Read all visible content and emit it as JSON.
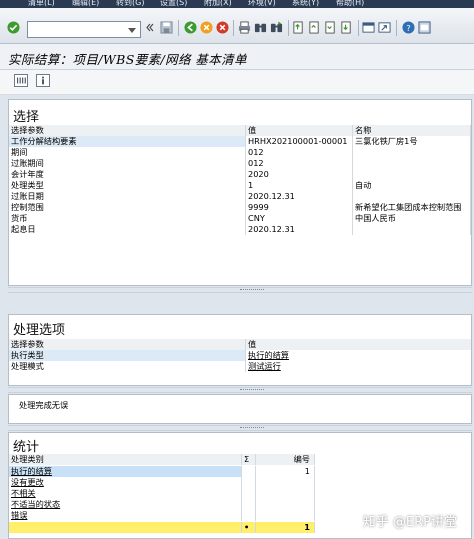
{
  "menu": [
    "清单(L)",
    "编辑(E)",
    "转到(G)",
    "设置(S)",
    "附加(X)",
    "环境(V)",
    "系统(Y)",
    "帮助(H)"
  ],
  "toolbar": {
    "command_field": ""
  },
  "page_title": "实际结算：项目/WBS要素/网络 基本清单",
  "selection": {
    "title": "选择",
    "headers": [
      "选择参数",
      "值",
      "名称"
    ],
    "rows": [
      [
        "工作分解结构要素",
        "HRHX202100001-00001",
        "三氯化铁厂房1号"
      ],
      [
        "期间",
        "012",
        ""
      ],
      [
        "过账期间",
        "012",
        ""
      ],
      [
        "会计年度",
        "2020",
        ""
      ],
      [
        "处理类型",
        "1",
        "自动"
      ],
      [
        "过账日期",
        "2020.12.31",
        ""
      ],
      [
        "控制范围",
        "9999",
        "新希望化工集团成本控制范围"
      ],
      [
        "货币",
        "CNY",
        "中国人民币"
      ],
      [
        "起息日",
        "2020.12.31",
        ""
      ]
    ]
  },
  "processing": {
    "title": "处理选项",
    "headers": [
      "选择参数",
      "值"
    ],
    "rows": [
      [
        "执行类型",
        "执行的结算"
      ],
      [
        "处理模式",
        "测试运行"
      ]
    ]
  },
  "message": "处理完成无误",
  "stats": {
    "title": "统计",
    "headers": [
      "处理类别",
      "Σ",
      "编号"
    ],
    "rows": [
      [
        "执行的结算",
        "",
        "1"
      ],
      [
        "没有更改",
        "",
        ""
      ],
      [
        "不相关",
        "",
        ""
      ],
      [
        "不适当的状态",
        "",
        ""
      ],
      [
        "错误",
        "",
        ""
      ]
    ],
    "total": [
      "",
      "•",
      "1"
    ]
  },
  "watermark": "知乎 @ERP讲堂",
  "colors": {
    "accent": "#0a6ed1",
    "highlight_row": "#dbeaf6",
    "total_row": "#ffef6b"
  }
}
